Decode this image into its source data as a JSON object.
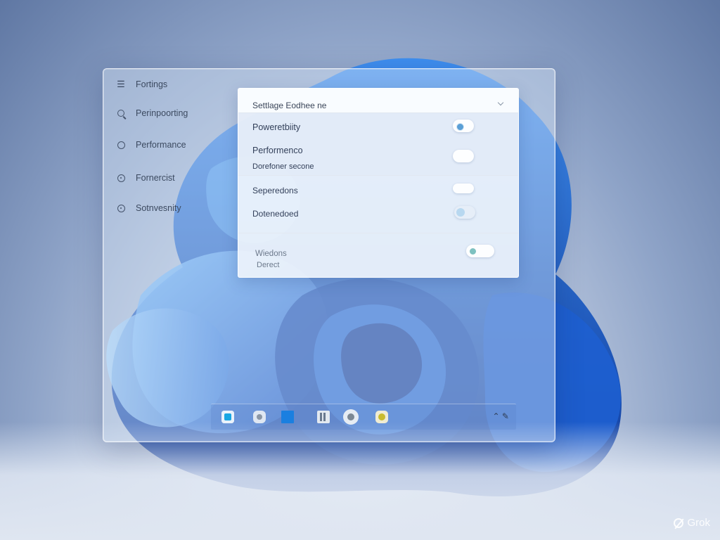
{
  "sidebar": {
    "items": [
      {
        "label": "Fortings",
        "icon": "menu-icon"
      },
      {
        "label": "Perinpoorting",
        "icon": "search-icon"
      },
      {
        "label": "Performance",
        "icon": "circle-icon"
      },
      {
        "label": "Fornercist",
        "icon": "info-circle-icon"
      },
      {
        "label": "Sotnvesnity",
        "icon": "target-icon"
      }
    ]
  },
  "panel": {
    "title": "Settlage Eodhee ne",
    "rows": [
      {
        "label": "Poweretbiity",
        "toggle": "on"
      },
      {
        "label": "Performenco",
        "sublabel": "Dorefoner secone",
        "toggle": "off"
      },
      {
        "label": "Seperedons",
        "toggle": "off"
      },
      {
        "label": "Dotenedoed",
        "toggle": "partial"
      },
      {
        "label": "Wiedons",
        "sublabel": "Derect",
        "toggle": "on"
      }
    ]
  },
  "taskbar": {
    "icons": [
      "start-icon",
      "search-icon",
      "widgets-icon",
      "file-explorer-icon",
      "browser-icon",
      "store-icon"
    ],
    "tray": "⌃ ✎"
  },
  "watermark": "Grok",
  "colors": {
    "accent": "#1a7fe0",
    "toggle_knob_on": "#5a9fd6"
  }
}
